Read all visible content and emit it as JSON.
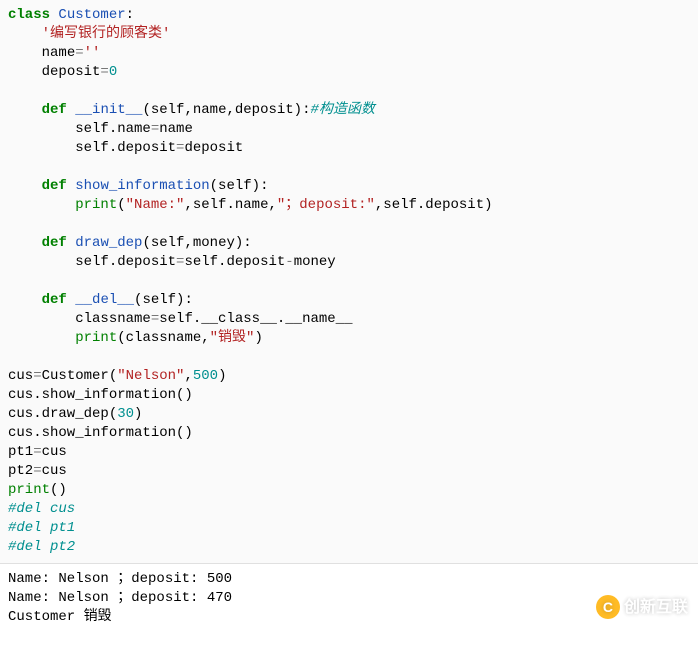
{
  "code": {
    "l1_kw": "class",
    "l1_cls": "Customer",
    "l1_colon": ":",
    "l2_doc": "'编写银行的顾客类'",
    "l3_name": "name",
    "l3_eq": "=",
    "l3_val": "''",
    "l4_name": "deposit",
    "l4_eq": "=",
    "l4_val": "0",
    "l6_def": "def",
    "l6_fn": "__init__",
    "l6_args": "(self,name,deposit):",
    "l6_cmt": "#构造函数",
    "l7": "self.name",
    "l7_eq": "=",
    "l7_rhs": "name",
    "l8": "self.deposit",
    "l8_eq": "=",
    "l8_rhs": "deposit",
    "l10_def": "def",
    "l10_fn": "show_information",
    "l10_args": "(self):",
    "l11_print": "print",
    "l11_s1": "\"Name:\"",
    "l11_m1": ",self.name,",
    "l11_s2": "\"；deposit:\"",
    "l11_m2": ",self.deposit)",
    "l11_open": "(",
    "l13_def": "def",
    "l13_fn": "draw_dep",
    "l13_args": "(self,money):",
    "l14_lhs": "self.deposit",
    "l14_eq": "=",
    "l14_mid": "self.deposit",
    "l14_minus": "-",
    "l14_rhs": "money",
    "l16_def": "def",
    "l16_fn": "__del__",
    "l16_args": "(self):",
    "l17_lhs": "classname",
    "l17_eq": "=",
    "l17_rhs": "self.__class__.__name__",
    "l18_print": "print",
    "l18_open": "(classname,",
    "l18_str": "\"销毁\"",
    "l18_close": ")",
    "l20_lhs": "cus",
    "l20_eq": "=",
    "l20_cls": "Customer(",
    "l20_s": "\"Nelson\"",
    "l20_comma": ",",
    "l20_num": "500",
    "l20_close": ")",
    "l21": "cus.show_information()",
    "l22_lhs": "cus.draw_dep(",
    "l22_num": "30",
    "l22_close": ")",
    "l23": "cus.show_information()",
    "l24_lhs": "pt1",
    "l24_eq": "=",
    "l24_rhs": "cus",
    "l25_lhs": "pt2",
    "l25_eq": "=",
    "l25_rhs": "cus",
    "l26_print": "print",
    "l26_args": "()",
    "l27_cmt": "#del cus",
    "l28_cmt": "#del pt1",
    "l29_cmt": "#del pt2"
  },
  "output": {
    "line1": "Name: Nelson ；deposit: 500",
    "line2": "Name: Nelson ；deposit: 470",
    "line3": "Customer 销毁"
  },
  "watermark": {
    "text": "创新互联",
    "icon": "C"
  }
}
